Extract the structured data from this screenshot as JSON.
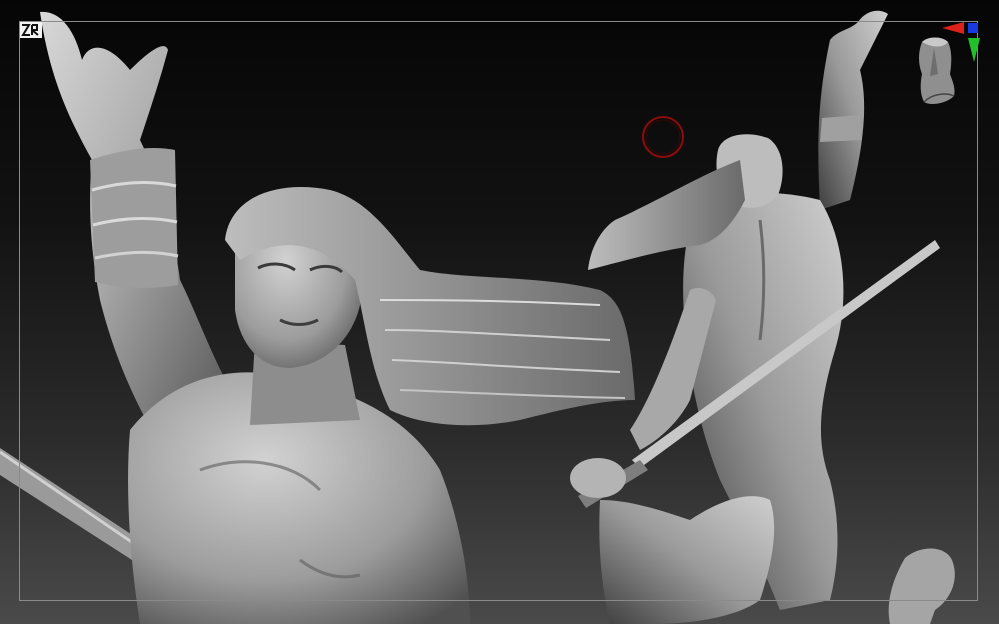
{
  "app": {
    "view": "3D Viewport",
    "icons": {
      "logo": "zbrush-logo-icon",
      "gizmo": "navigation-gizmo-icon",
      "cursor": "brush-cursor-icon"
    }
  },
  "colors": {
    "frame": "#8a8a8a",
    "cursor": "#8b0c0c",
    "axis_x": "#e0201a",
    "axis_y": "#22c02a",
    "axis_z": "#1a3ae0",
    "clay_light": "#d4d4d4",
    "clay_mid": "#8e8e8e",
    "clay_dark": "#3a3a3a"
  }
}
